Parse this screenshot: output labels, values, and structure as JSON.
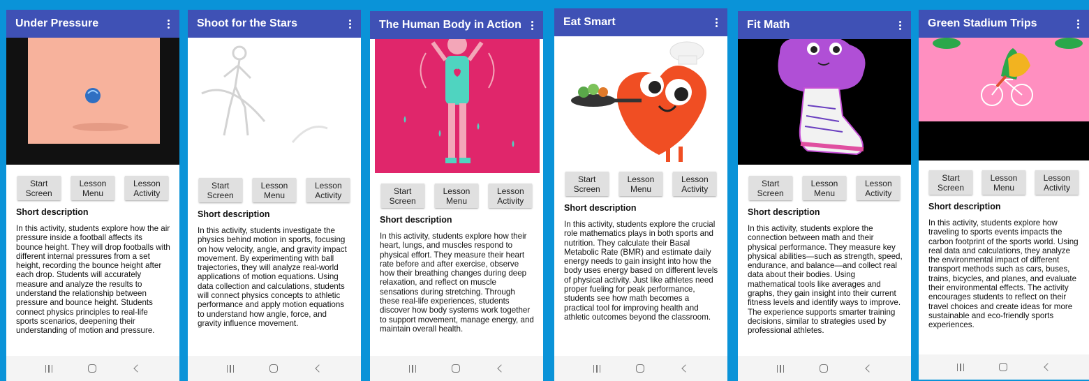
{
  "buttons": {
    "start_screen": "Start Screen",
    "lesson_menu": "Lesson Menu",
    "lesson_activity": "Lesson Activity"
  },
  "short_description_label": "Short description",
  "colors": {
    "background": "#0a93d8",
    "app_bar": "#3f51b5",
    "button": "#e0e0e0"
  },
  "icons": {
    "menu": "more-vert-icon",
    "nav_recent": "recent-apps-icon",
    "nav_home": "home-icon",
    "nav_back": "back-icon"
  },
  "screens": [
    {
      "title": "Under Pressure",
      "description": "In this activity, students explore how the air pressure inside a football affects its bounce height. They will drop footballs with different internal pressures from a set height, recording the bounce height after each drop. Students will accurately measure and analyze the results to understand the relationship between pressure and bounce height.  Students connect physics principles to real-life sports scenarios, deepening their understanding of motion and pressure."
    },
    {
      "title": "Shoot for the Stars",
      "description": "In this activity, students investigate the physics behind motion in sports, focusing on how velocity, angle, and gravity impact movement. By experimenting with ball trajectories, they will analyze real-world applications of motion equations. Using data collection and calculations, students will connect physics concepts to athletic performance and apply motion equations to understand how angle, force, and gravity influence movement."
    },
    {
      "title": "The Human Body in Action",
      "description": "In this activity, students explore how their heart, lungs, and muscles respond to physical effort. They measure their heart rate before and after exercise, observe how their breathing changes during deep relaxation, and reflect on muscle sensations during stretching. Through these real-life experiences, students discover how body systems work together to support movement, manage energy, and maintain overall health."
    },
    {
      "title": "Eat Smart",
      "description": "In this activity, students explore the crucial role mathematics plays in both sports and nutrition. They calculate their Basal Metabolic Rate (BMR) and estimate daily energy needs to gain insight into how the body uses energy based on different levels of physical activity. Just like athletes need proper fueling for peak performance, students see how math becomes a practical tool for improving health and athletic outcomes beyond the classroom."
    },
    {
      "title": "Fit Math",
      "description": "In this activity, students explore the connection between math and their physical performance. They measure key physical abilities—such as strength, speed, endurance, and balance—and collect real data about their bodies. Using mathematical tools like averages and graphs, they gain insight into their current fitness levels and identify ways to improve. The experience supports smarter training decisions, similar to strategies used by professional athletes."
    },
    {
      "title": "Green Stadium Trips",
      "description": "In this activity, students explore how traveling to sports events impacts the carbon footprint of the sports world. Using real data and calculations, they analyze the environmental impact of different transport methods such as cars, buses, trains, bicycles, and planes, and evaluate their environmental effects. The activity encourages students to reflect on their travel choices and create ideas for more sustainable and eco-friendly sports experiences."
    }
  ]
}
